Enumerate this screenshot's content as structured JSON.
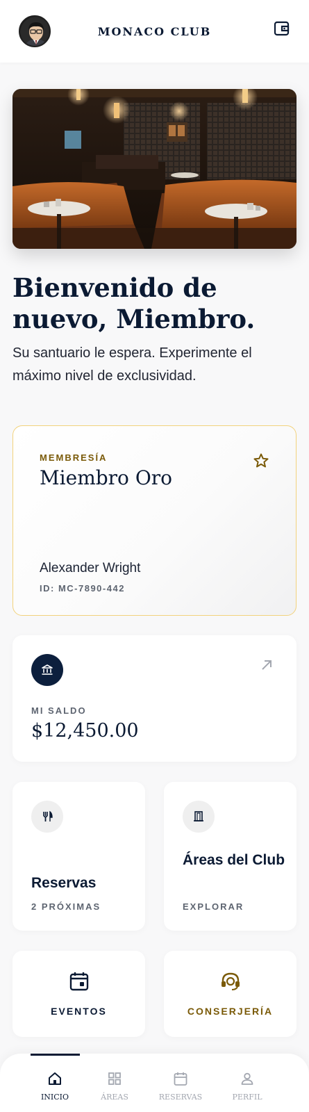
{
  "header": {
    "brand": "MONACO CLUB"
  },
  "welcome": {
    "title": "Bienvenido de nuevo, Miembro.",
    "subtitle": "Su santuario le espera. Experimente el máximo nivel de exclusividad."
  },
  "membership": {
    "label": "MEMBRESÍA",
    "tier": "Miembro Oro",
    "name": "Alexander Wright",
    "id": "ID: MC-7890-442"
  },
  "balance": {
    "label": "MI SALDO",
    "value": "$12,450.00"
  },
  "cards": {
    "reservations": {
      "title": "Reservas",
      "subtitle": "2 PRÓXIMAS"
    },
    "areas": {
      "title": "Áreas del Club",
      "subtitle": "EXPLORAR"
    }
  },
  "actions": {
    "events": "EVENTOS",
    "concierge": "CONSERJERÍA"
  },
  "nav": [
    {
      "label": "INICIO",
      "icon": "home-icon",
      "active": true
    },
    {
      "label": "ÁREAS",
      "icon": "grid-icon",
      "active": false
    },
    {
      "label": "RESERVAS",
      "icon": "calendar-icon",
      "active": false
    },
    {
      "label": "PERFIL",
      "icon": "person-icon",
      "active": false
    }
  ],
  "colors": {
    "navy": "#0b1a33",
    "gold": "#7a5a08",
    "gold_border": "#f2d27c",
    "muted": "#5d6470",
    "background": "#f8f8f9"
  }
}
